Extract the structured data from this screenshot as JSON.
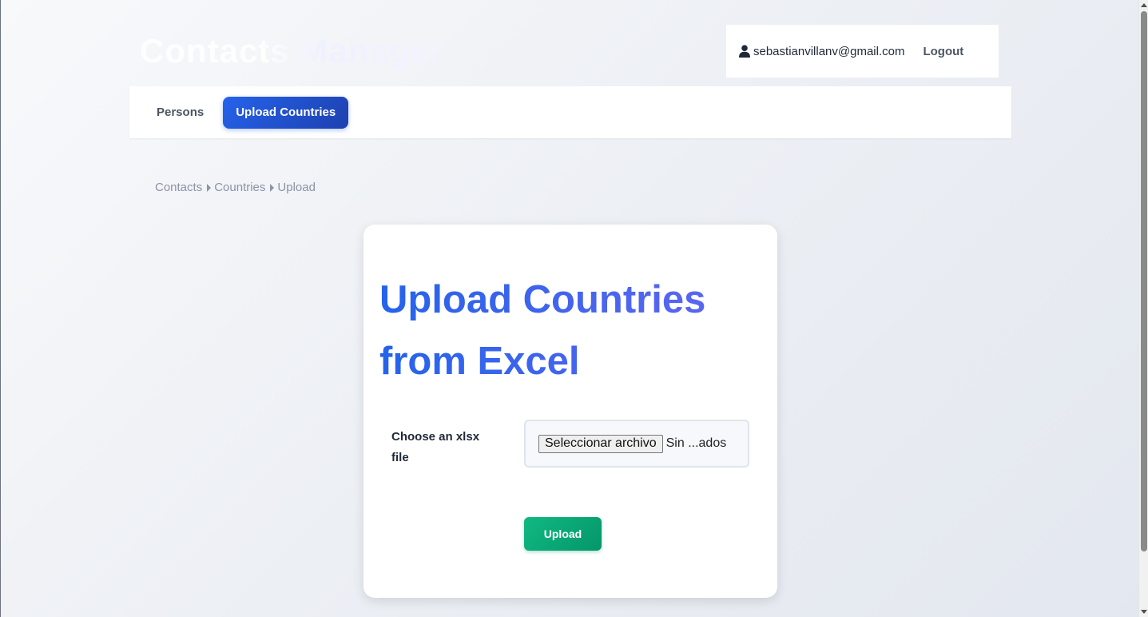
{
  "app": {
    "title": "Contacts Manager"
  },
  "user": {
    "email": "sebastianvillanv@gmail.com",
    "logout_label": "Logout",
    "icon": "user-icon"
  },
  "nav": {
    "items": [
      {
        "label": "Persons",
        "active": false
      },
      {
        "label": "Upload Countries",
        "active": true
      }
    ]
  },
  "breadcrumb": [
    "Contacts",
    "Countries",
    "Upload"
  ],
  "card": {
    "title": "Upload Countries from Excel",
    "field_label": "Choose an xlsx file",
    "file_button_label": "Seleccionar archivo",
    "file_status": "Sin ...ados",
    "submit_label": "Upload"
  },
  "colors": {
    "nav_active": "#2563eb",
    "title_gradient_start": "#2563eb",
    "title_gradient_end": "#6366f1",
    "upload_button": "#10b981"
  }
}
